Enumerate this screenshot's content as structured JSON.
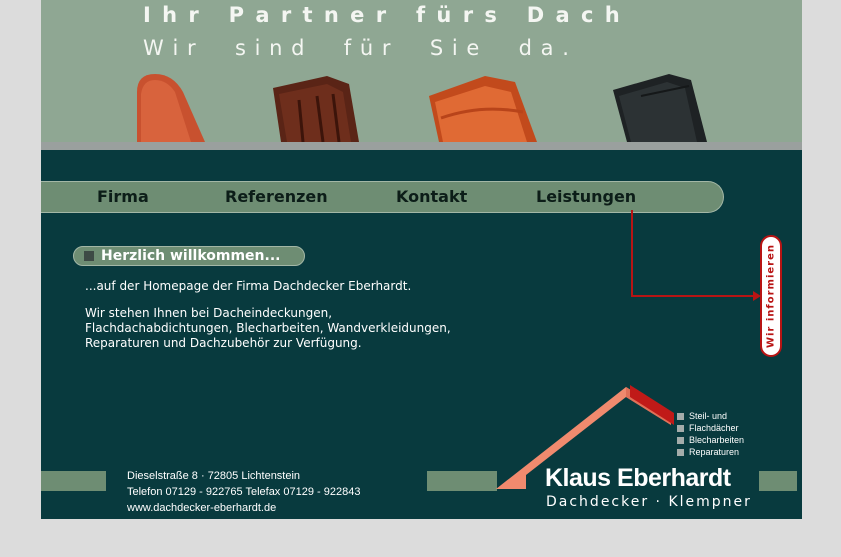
{
  "header": {
    "slogan_line1": "I h r   P a r t n e r   f ü r s   D a c h",
    "slogan_line2": "W i r     s i n d     f ü r     S i e     d a ."
  },
  "nav": {
    "items": [
      {
        "label": "Firma"
      },
      {
        "label": "Referenzen"
      },
      {
        "label": "Kontakt"
      },
      {
        "label": "Leistungen"
      }
    ]
  },
  "welcome": {
    "title": "Herzlich willkommen...",
    "intro": "...auf der Homepage der Firma Dachdecker Eberhardt.",
    "lines": [
      "Wir stehen Ihnen bei Dacheindeckungen,",
      "Flachdachabdichtungen, Blecharbeiten, Wandverkleidungen,",
      "Reparaturen und Dachzubehör zur Verfügung."
    ]
  },
  "info_button": {
    "label": "Wir informieren"
  },
  "footer": {
    "address": "Dieselstraße 8 · 72805 Lichtenstein",
    "phone": "Telefon  07129 - 922765  Telefax  07129 - 922843",
    "website": "www.dachdecker-eberhardt.de"
  },
  "services": [
    "Steil- und",
    "Flachdächer",
    "Blecharbeiten",
    "Reparaturen"
  ],
  "brand": {
    "name": "Klaus Eberhardt",
    "tagline": "Dachdecker · Klempner"
  },
  "colors": {
    "background": "#083a3e",
    "header": "#8fa793",
    "nav": "#6e8d73",
    "accent": "#b81414",
    "roof": "#f08a6e"
  }
}
